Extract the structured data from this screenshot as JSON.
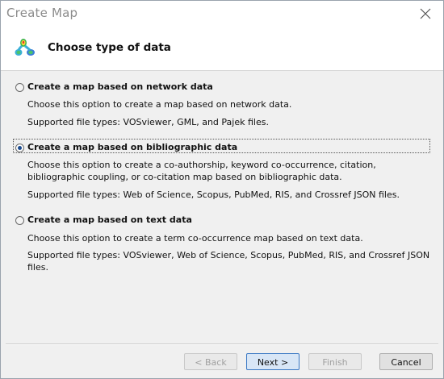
{
  "window": {
    "title": "Create Map"
  },
  "header": {
    "title": "Choose type of data"
  },
  "options": [
    {
      "label": "Create a map based on network data",
      "selected": false,
      "description": "Choose this option to create a map based on network data.",
      "file_types": "Supported file types: VOSviewer, GML, and Pajek files."
    },
    {
      "label": "Create a map based on bibliographic data",
      "selected": true,
      "description": "Choose this option to create a co-authorship, keyword co-occurrence, citation, bibliographic coupling, or co-citation map based on bibliographic data.",
      "file_types": "Supported file types: Web of Science, Scopus, PubMed, RIS, and Crossref JSON files."
    },
    {
      "label": "Create a map based on text data",
      "selected": false,
      "description": "Choose this option to create a term co-occurrence map based on text data.",
      "file_types": "Supported file types: VOSviewer, Web of Science, Scopus, PubMed, RIS, and Crossref JSON files."
    }
  ],
  "buttons": {
    "back": "< Back",
    "next": "Next >",
    "finish": "Finish",
    "cancel": "Cancel"
  },
  "icons": {
    "close": "close-icon",
    "app": "vosviewer-app-icon"
  },
  "colors": {
    "accent": "#1b4a8f",
    "primary_button_border": "#3a78c4"
  }
}
